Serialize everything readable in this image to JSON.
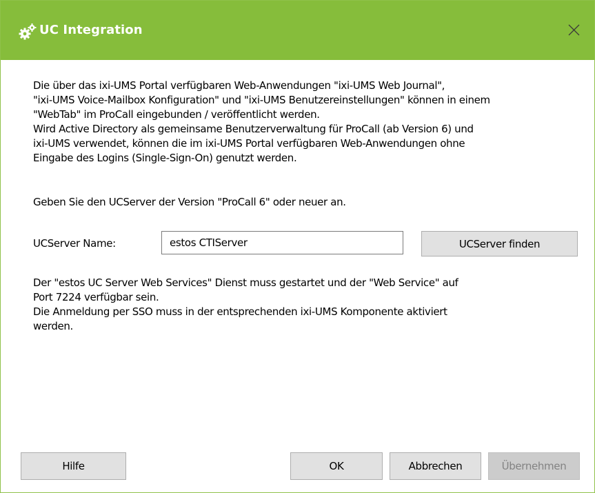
{
  "window": {
    "title": "UC Integration",
    "title_icon": "gears-icon",
    "close_icon": "close-icon",
    "accent_color": "#86bd3b"
  },
  "content": {
    "intro_lines": [
      "Die über das ixi-UMS Portal verfügbaren Web-Anwendungen \"ixi-UMS Web Journal\",",
      "\"ixi-UMS Voice-Mailbox Konfiguration\" und \"ixi-UMS Benutzereinstellungen\" können in einem",
      "\"WebTab\" im ProCall eingebunden / veröffentlicht werden.",
      "Wird Active Directory als gemeinsame Benutzerverwaltung für ProCall (ab Version 6) und",
      "ixi-UMS verwendet, können die im ixi-UMS Portal verfügbaren Web-Anwendungen ohne",
      "Eingabe des Logins (Single-Sign-On) genutzt werden."
    ],
    "prompt": "Geben Sie den UCServer der Version \"ProCall 6\" oder neuer an.",
    "ucserver_label": "UCServer Name:",
    "ucserver_value": "estos CTIServer",
    "find_button": "UCServer finden",
    "note_lines": [
      "Der \"estos UC Server Web Services\" Dienst muss gestartet und der \"Web Service\" auf",
      "Port 7224 verfügbar sein.",
      "Die Anmeldung per SSO muss in der entsprechenden ixi-UMS Komponente aktiviert",
      "werden."
    ]
  },
  "buttons": {
    "help": "Hilfe",
    "ok": "OK",
    "cancel": "Abbrechen",
    "apply": "Übernehmen",
    "apply_enabled": false
  }
}
